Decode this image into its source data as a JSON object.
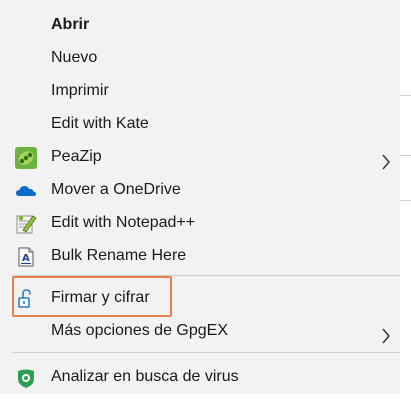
{
  "menu": {
    "items": [
      {
        "label": "Abrir",
        "bold": true
      },
      {
        "label": "Nuevo"
      },
      {
        "label": "Imprimir"
      },
      {
        "label": "Edit with Kate"
      },
      {
        "label": "PeaZip",
        "icon": "peazip-icon",
        "submenu": true
      },
      {
        "label": "Mover a OneDrive",
        "icon": "onedrive-cloud-icon"
      },
      {
        "label": "Edit with Notepad++",
        "icon": "notepadplusplus-icon"
      },
      {
        "label": "Bulk Rename Here",
        "icon": "bulk-rename-icon"
      },
      {
        "label": "Firmar y cifrar",
        "icon": "open-padlock-icon",
        "highlighted": true
      },
      {
        "label": "Más opciones de GpgEX",
        "submenu": true
      },
      {
        "label": "Analizar en busca de virus",
        "icon": "antivirus-shield-icon"
      }
    ]
  },
  "colors": {
    "menu_bg": "#f2f2f2",
    "highlight_border": "#e8804e",
    "onedrive_blue": "#0a6ccb",
    "antivirus_green": "#2e9e57",
    "peazip_green": "#6cb33f"
  }
}
